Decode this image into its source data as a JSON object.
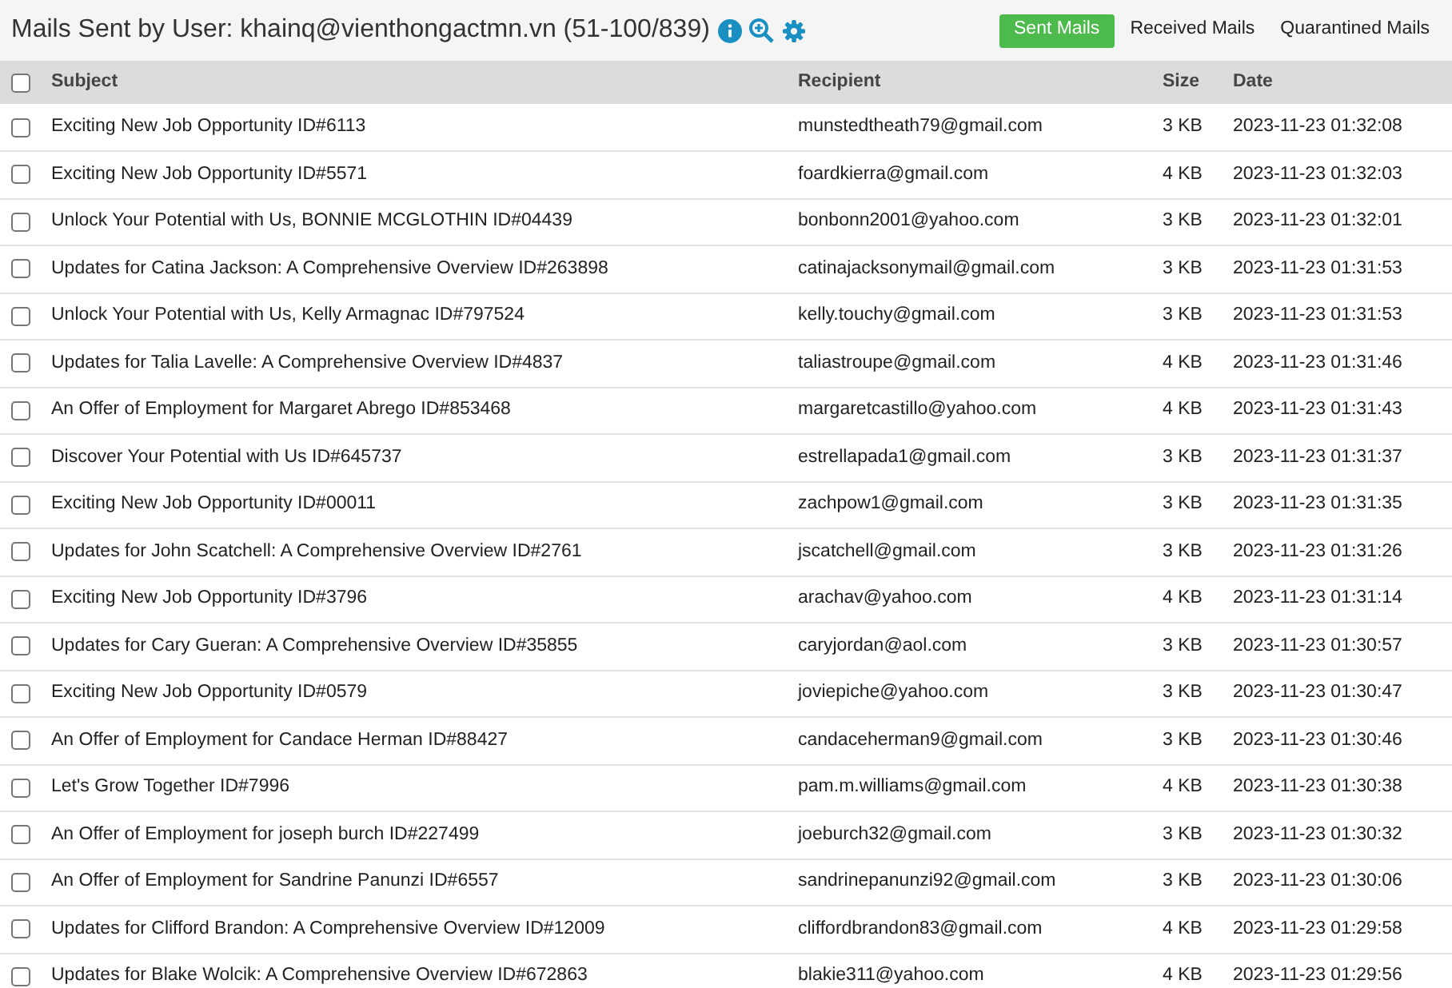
{
  "header": {
    "title": "Mails Sent by User: khainq@vienthongactmn.vn (51-100/839)",
    "tabs": [
      {
        "label": "Sent Mails",
        "selected": true
      },
      {
        "label": "Received Mails",
        "selected": false
      },
      {
        "label": "Quarantined Mails",
        "selected": false
      }
    ]
  },
  "table": {
    "select_all_checked": false,
    "columns": [
      "Subject",
      "Recipient",
      "Size",
      "Date"
    ],
    "rows": [
      {
        "checked": false,
        "subject": "Exciting New Job Opportunity ID#6113",
        "recipient": "munstedtheath79@gmail.com",
        "size": "3 KB",
        "date": "2023-11-23 01:32:08"
      },
      {
        "checked": false,
        "subject": "Exciting New Job Opportunity ID#5571",
        "recipient": "foardkierra@gmail.com",
        "size": "4 KB",
        "date": "2023-11-23 01:32:03"
      },
      {
        "checked": false,
        "subject": "Unlock Your Potential with Us, BONNIE MCGLOTHIN ID#04439",
        "recipient": "bonbonn2001@yahoo.com",
        "size": "3 KB",
        "date": "2023-11-23 01:32:01"
      },
      {
        "checked": false,
        "subject": "Updates for Catina Jackson: A Comprehensive Overview ID#263898",
        "recipient": "catinajacksonymail@gmail.com",
        "size": "3 KB",
        "date": "2023-11-23 01:31:53"
      },
      {
        "checked": false,
        "subject": "Unlock Your Potential with Us, Kelly Armagnac ID#797524",
        "recipient": "kelly.touchy@gmail.com",
        "size": "3 KB",
        "date": "2023-11-23 01:31:53"
      },
      {
        "checked": false,
        "subject": "Updates for Talia Lavelle: A Comprehensive Overview ID#4837",
        "recipient": "taliastroupe@gmail.com",
        "size": "4 KB",
        "date": "2023-11-23 01:31:46"
      },
      {
        "checked": false,
        "subject": "An Offer of Employment for Margaret Abrego ID#853468",
        "recipient": "margaretcastillo@yahoo.com",
        "size": "4 KB",
        "date": "2023-11-23 01:31:43"
      },
      {
        "checked": false,
        "subject": "Discover Your Potential with Us ID#645737",
        "recipient": "estrellapada1@gmail.com",
        "size": "3 KB",
        "date": "2023-11-23 01:31:37"
      },
      {
        "checked": false,
        "subject": "Exciting New Job Opportunity ID#00011",
        "recipient": "zachpow1@gmail.com",
        "size": "3 KB",
        "date": "2023-11-23 01:31:35"
      },
      {
        "checked": false,
        "subject": "Updates for John Scatchell: A Comprehensive Overview ID#2761",
        "recipient": "jscatchell@gmail.com",
        "size": "3 KB",
        "date": "2023-11-23 01:31:26"
      },
      {
        "checked": false,
        "subject": "Exciting New Job Opportunity ID#3796",
        "recipient": "arachav@yahoo.com",
        "size": "4 KB",
        "date": "2023-11-23 01:31:14"
      },
      {
        "checked": false,
        "subject": "Updates for Cary Gueran: A Comprehensive Overview ID#35855",
        "recipient": "caryjordan@aol.com",
        "size": "3 KB",
        "date": "2023-11-23 01:30:57"
      },
      {
        "checked": false,
        "subject": "Exciting New Job Opportunity ID#0579",
        "recipient": "joviepiche@yahoo.com",
        "size": "3 KB",
        "date": "2023-11-23 01:30:47"
      },
      {
        "checked": false,
        "subject": "An Offer of Employment for Candace Herman ID#88427",
        "recipient": "candaceherman9@gmail.com",
        "size": "3 KB",
        "date": "2023-11-23 01:30:46"
      },
      {
        "checked": false,
        "subject": "Let's Grow Together ID#7996",
        "recipient": "pam.m.williams@gmail.com",
        "size": "4 KB",
        "date": "2023-11-23 01:30:38"
      },
      {
        "checked": false,
        "subject": "An Offer of Employment for joseph burch ID#227499",
        "recipient": "joeburch32@gmail.com",
        "size": "3 KB",
        "date": "2023-11-23 01:30:32"
      },
      {
        "checked": false,
        "subject": "An Offer of Employment for Sandrine Panunzi ID#6557",
        "recipient": "sandrinepanunzi92@gmail.com",
        "size": "3 KB",
        "date": "2023-11-23 01:30:06"
      },
      {
        "checked": false,
        "subject": "Updates for Clifford Brandon: A Comprehensive Overview ID#12009",
        "recipient": "cliffordbrandon83@gmail.com",
        "size": "4 KB",
        "date": "2023-11-23 01:29:58"
      },
      {
        "checked": false,
        "subject": "Updates for Blake Wolcik: A Comprehensive Overview ID#672863",
        "recipient": "blakie311@yahoo.com",
        "size": "4 KB",
        "date": "2023-11-23 01:29:56"
      }
    ]
  }
}
